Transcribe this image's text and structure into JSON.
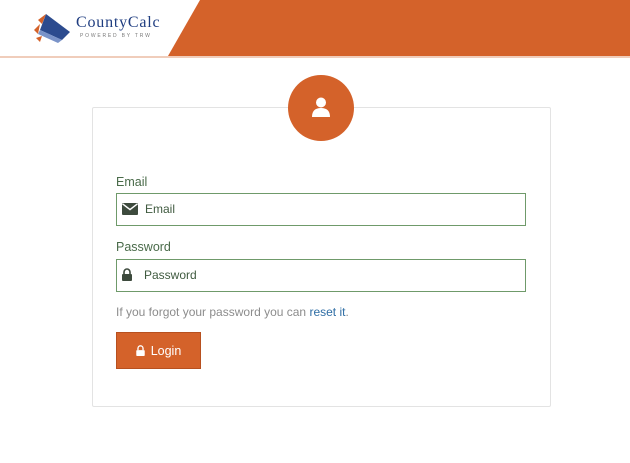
{
  "header": {
    "logo_name": "CountyCalc",
    "logo_tagline": "POWERED BY TRW",
    "brand_color": "#d4622a"
  },
  "login_form": {
    "email_label": "Email",
    "email_placeholder": "Email",
    "email_icon": "envelope-icon",
    "password_label": "Password",
    "password_placeholder": "Password",
    "password_icon": "lock-icon",
    "forgot_text": "If you forgot your password you can",
    "reset_link": "reset it",
    "forgot_suffix": ".",
    "login_label": "Login",
    "login_icon": "lock-icon",
    "avatar_icon": "user-icon",
    "link_color": "#2e6da4",
    "field_border_color": "#6f9a6a"
  }
}
